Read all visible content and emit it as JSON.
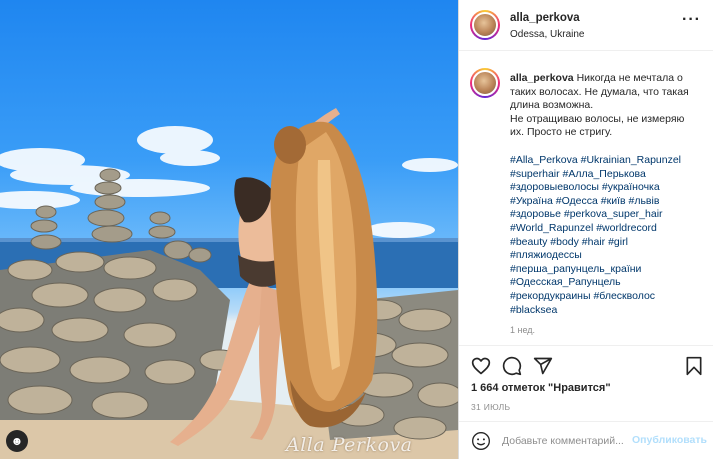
{
  "post": {
    "username": "alla_perkova",
    "location": "Odessa, Ukraine",
    "more_icon": "more-horizontal-icon",
    "watermark": "Alla Perkova",
    "photo_tag_icon": "user-tag-icon"
  },
  "caption": {
    "username": "alla_perkova",
    "lines": [
      "Никогда не мечтала о",
      "таких волосах. Не думала, что такая",
      "длина возможна.",
      "Не отращиваю волосы, не измеряю",
      "их. Просто не стригу."
    ],
    "hashtags": [
      "#Alla_Perkova #Ukrainian_Rapunzel",
      "#superhair #Алла_Перькова",
      "#здоровыеволосы #україночка",
      "#Україна #Одесса #київ #львів",
      "#здоровье #perkova_super_hair",
      "#World_Rapunzel #worldrecord",
      "#beauty #body #hair #girl",
      "#пляжиодессы",
      "#перша_рапунцель_країни",
      "#Одесская_Рапунцель",
      "#рекордукраины #блескволос",
      "#blacksea"
    ],
    "time_ago": "1 нед."
  },
  "actions": {
    "icons": [
      "heart-icon",
      "comment-icon",
      "share-icon",
      "bookmark-icon"
    ],
    "likes_text": "1 664 отметок \"Нравится\"",
    "date": "31 ИЮЛЬ"
  },
  "comment": {
    "emoji_icon": "emoji-icon",
    "placeholder": "Добавьте комментарий...",
    "publish_label": "Опубликовать"
  },
  "colors": {
    "link": "#00376b",
    "publish_disabled": "#b2dffc",
    "muted": "#8e8e8e"
  }
}
